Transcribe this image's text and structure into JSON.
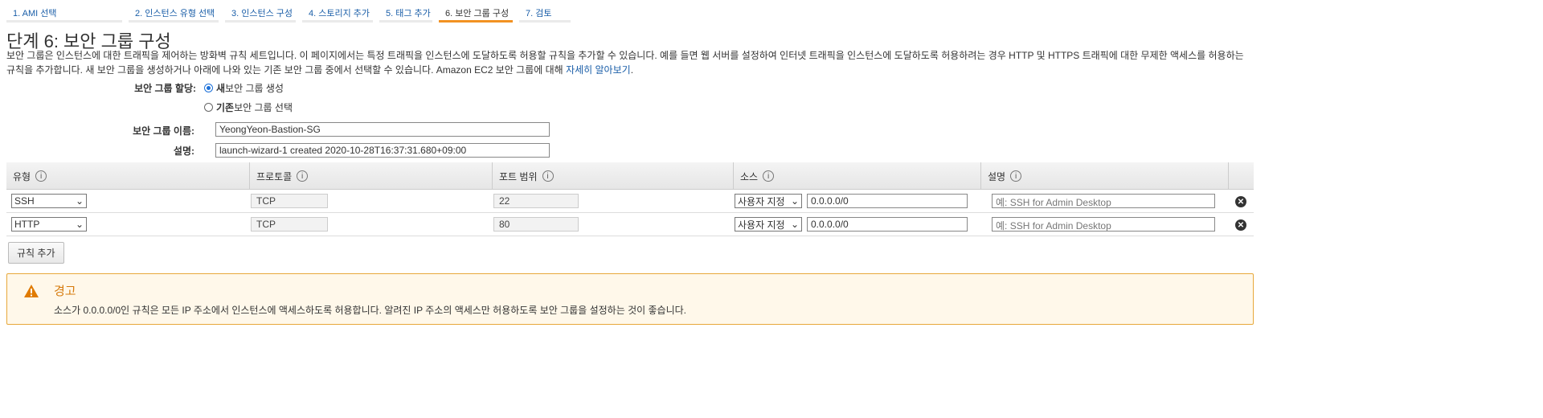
{
  "tabs": [
    "1. AMI 선택",
    "2. 인스턴스 유형 선택",
    "3. 인스턴스 구성",
    "4. 스토리지 추가",
    "5. 태그 추가",
    "6. 보안 그룹 구성",
    "7. 검토"
  ],
  "title": "단계 6: 보안 그룹 구성",
  "description": "보안 그룹은 인스턴스에 대한 트래픽을 제어하는 방화벽 규칙 세트입니다. 이 페이지에서는 특정 트래픽을 인스턴스에 도달하도록 허용할 규칙을 추가할 수 있습니다. 예를 들면 웹 서버를 설정하여 인터넷 트래픽을 인스턴스에 도달하도록 허용하려는 경우 HTTP 및 HTTPS 트래픽에 대한 무제한 액세스를 허용하는 규칙을 추가합니다. 새 보안 그룹을 생성하거나 아래에 나와 있는 기존 보안 그룹 중에서 선택할 수 있습니다. Amazon EC2 보안 그룹에 대해 ",
  "learn_more": "자세히 알아보기",
  "assign_label": "보안 그룹 할당:",
  "radio_new_bold": "새",
  "radio_new": " 보안 그룹 생성",
  "radio_existing_bold": "기존",
  "radio_existing": " 보안 그룹 선택",
  "name_label": "보안 그룹 이름:",
  "name_value": "YeongYeon-Bastion-SG",
  "desc_label": "설명:",
  "desc_value": "launch-wizard-1 created 2020-10-28T16:37:31.680+09:00",
  "headers": [
    "유형",
    "프로토콜",
    "포트 범위",
    "소스",
    "설명"
  ],
  "rows": [
    {
      "type": "SSH",
      "protocol": "TCP",
      "port": "22",
      "source_type": "사용자 지정",
      "source": "0.0.0.0/0",
      "desc_placeholder": "예: SSH for Admin Desktop"
    },
    {
      "type": "HTTP",
      "protocol": "TCP",
      "port": "80",
      "source_type": "사용자 지정",
      "source": "0.0.0.0/0",
      "desc_placeholder": "예: SSH for Admin Desktop"
    }
  ],
  "add_rule": "규칙 추가",
  "warning": {
    "title": "경고",
    "message": "소스가 0.0.0.0/0인 규칙은 모든 IP 주소에서 인스턴스에 액세스하도록 허용합니다. 알려진 IP 주소의 액세스만 허용하도록 보안 그룹을 설정하는 것이 좋습니다."
  }
}
